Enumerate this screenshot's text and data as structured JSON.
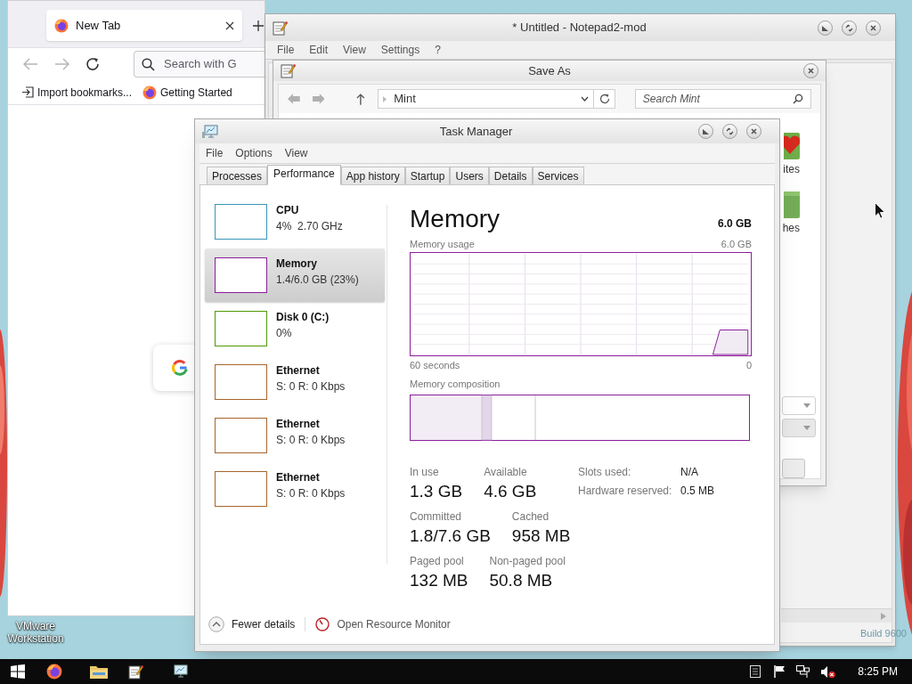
{
  "desktop": {
    "shortcut_label": "VMware Workstation",
    "build_label": "Build 9600"
  },
  "browser": {
    "tab_title": "New Tab",
    "search_placeholder": "Search with G",
    "bookmarks": [
      {
        "kind": "import",
        "label": "Import bookmarks..."
      },
      {
        "kind": "site",
        "label": "Getting Started"
      }
    ]
  },
  "notepad": {
    "title": "* Untitled - Notepad2-mod",
    "menu": [
      "File",
      "Edit",
      "View",
      "Settings",
      "?"
    ]
  },
  "save_as": {
    "title": "Save As",
    "path": "Mint",
    "search_placeholder": "Search Mint",
    "items": [
      {
        "kind": "favorites",
        "label": "ites"
      },
      {
        "kind": "folder",
        "label": "hes"
      }
    ]
  },
  "task_manager": {
    "title": "Task Manager",
    "menu": [
      "File",
      "Options",
      "View"
    ],
    "tabs": [
      {
        "label": "Processes",
        "selected": false
      },
      {
        "label": "Performance",
        "selected": true
      },
      {
        "label": "App history",
        "selected": false
      },
      {
        "label": "Startup",
        "selected": false
      },
      {
        "label": "Users",
        "selected": false
      },
      {
        "label": "Details",
        "selected": false
      },
      {
        "label": "Services",
        "selected": false
      }
    ],
    "resources": [
      {
        "name": "CPU",
        "reading": "4%  2.70 GHz",
        "selected": false,
        "color": "#3a95b8"
      },
      {
        "name": "Memory",
        "reading": "1.4/6.0 GB (23%)",
        "selected": true,
        "color": "#8b1e9b"
      },
      {
        "name": "Disk 0 (C:)",
        "reading": "0%",
        "selected": false,
        "color": "#4e9a06"
      },
      {
        "name": "Ethernet",
        "reading": "S: 0 R: 0 Kbps",
        "selected": false,
        "color": "#a7652b"
      },
      {
        "name": "Ethernet",
        "reading": "S: 0 R: 0 Kbps",
        "selected": false,
        "color": "#a7652b"
      },
      {
        "name": "Ethernet",
        "reading": "S: 0 R: 0 Kbps",
        "selected": false,
        "color": "#a7652b"
      }
    ],
    "detail": {
      "title": "Memory",
      "total": "6.0 GB",
      "usage_label": "Memory usage",
      "usage_max": "6.0 GB",
      "time_start": "60 seconds",
      "time_end": "0",
      "composition_label": "Memory composition",
      "stat_rows": [
        [
          {
            "label": "In use",
            "value": "1.3 GB"
          },
          {
            "label": "Available",
            "value": "4.6 GB"
          }
        ],
        [
          {
            "label": "Committed",
            "value": "1.8/7.6 GB"
          },
          {
            "label": "Cached",
            "value": "958 MB"
          }
        ],
        [
          {
            "label": "Paged pool",
            "value": "132 MB"
          },
          {
            "label": "Non-paged pool",
            "value": "50.8 MB"
          }
        ]
      ],
      "side_stats": [
        {
          "label": "Slots used:",
          "value": "N/A"
        },
        {
          "label": "Hardware reserved:",
          "value": "0.5 MB"
        }
      ]
    },
    "footer": {
      "fewer_details": "Fewer details",
      "resource_monitor": "Open Resource Monitor"
    }
  },
  "taskbar": {
    "clock": "8:25 PM"
  }
}
